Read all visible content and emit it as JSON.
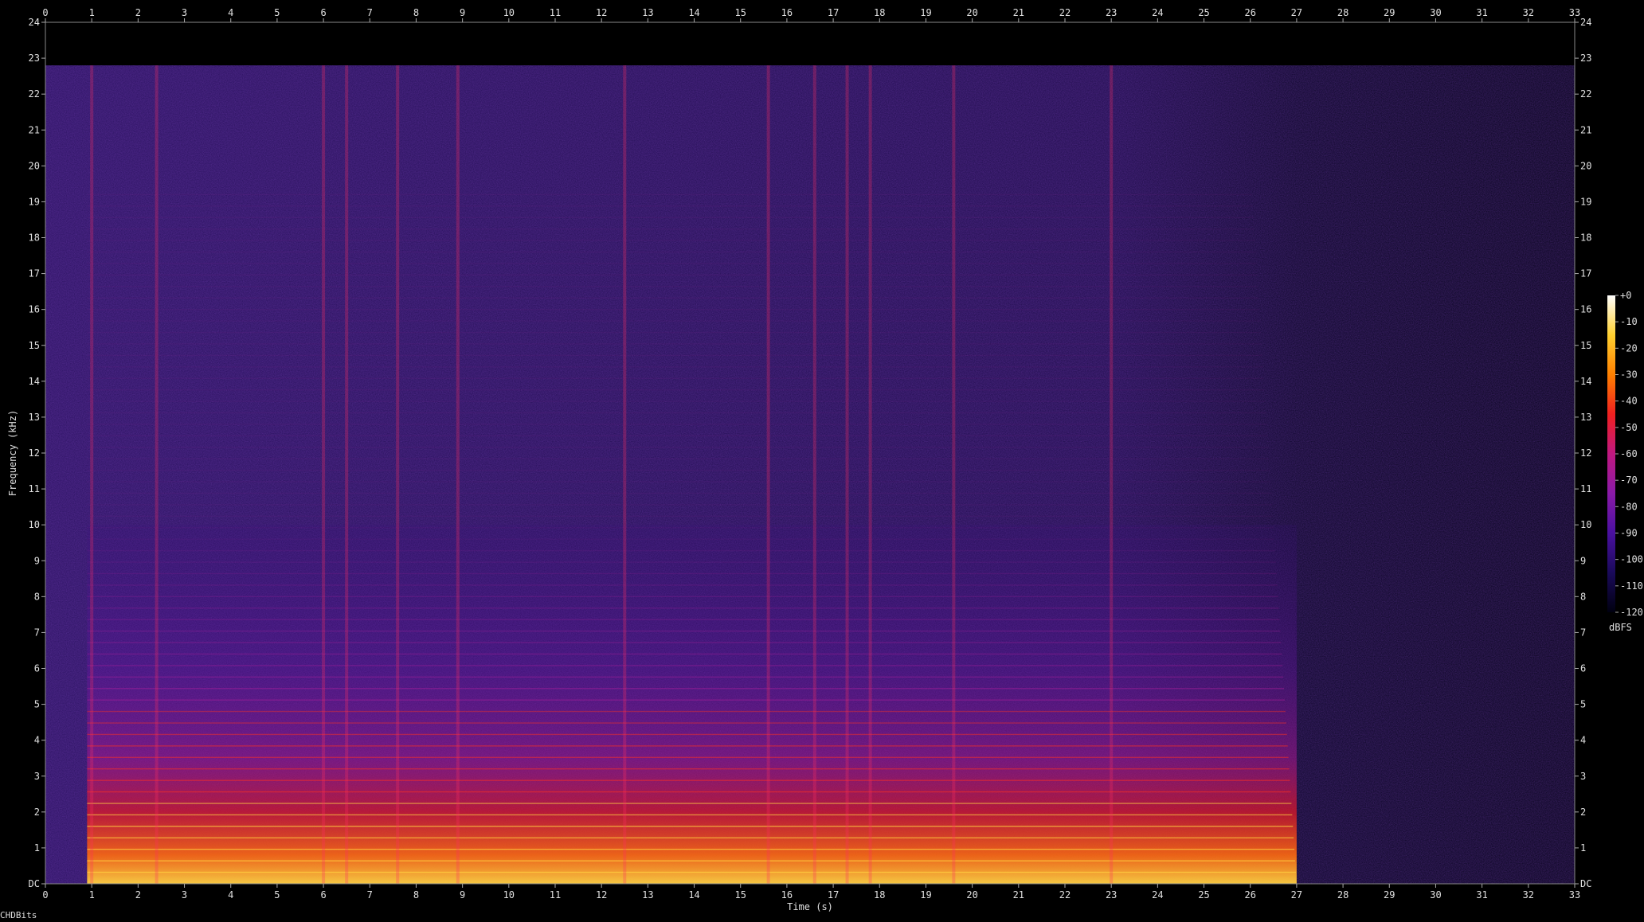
{
  "chart_data": {
    "type": "heatmap",
    "xlabel": "Time (s)",
    "ylabel": "Frequency (kHz)",
    "x_ticks": [
      "0",
      "1",
      "2",
      "3",
      "4",
      "5",
      "6",
      "7",
      "8",
      "9",
      "10",
      "11",
      "12",
      "13",
      "14",
      "15",
      "16",
      "17",
      "18",
      "19",
      "20",
      "21",
      "22",
      "23",
      "24",
      "25",
      "26",
      "27",
      "28",
      "29",
      "30",
      "31",
      "32",
      "33"
    ],
    "y_ticks": [
      "DC",
      "1",
      "2",
      "3",
      "4",
      "5",
      "6",
      "7",
      "8",
      "9",
      "10",
      "11",
      "12",
      "13",
      "14",
      "15",
      "16",
      "17",
      "18",
      "19",
      "20",
      "21",
      "22",
      "23",
      "24"
    ],
    "xlim": [
      0,
      33
    ],
    "ylim": [
      0,
      24
    ],
    "content_cutoff_khz": 22.8,
    "signal_end_s": 27,
    "colorbar": {
      "label": "dBFS",
      "ticks": [
        "+0",
        "-10",
        "-20",
        "-30",
        "-40",
        "-50",
        "-60",
        "-70",
        "-80",
        "-90",
        "-100",
        "-110",
        "-120"
      ],
      "range": [
        -120,
        0
      ],
      "colors": [
        "#000010",
        "#1a0a5a",
        "#4a10a0",
        "#8a1aa8",
        "#c01880",
        "#f02020",
        "#ff8000",
        "#ffd030",
        "#ffffff"
      ]
    },
    "background_color": "#000000"
  },
  "footer": {
    "text": "CHDBits"
  }
}
